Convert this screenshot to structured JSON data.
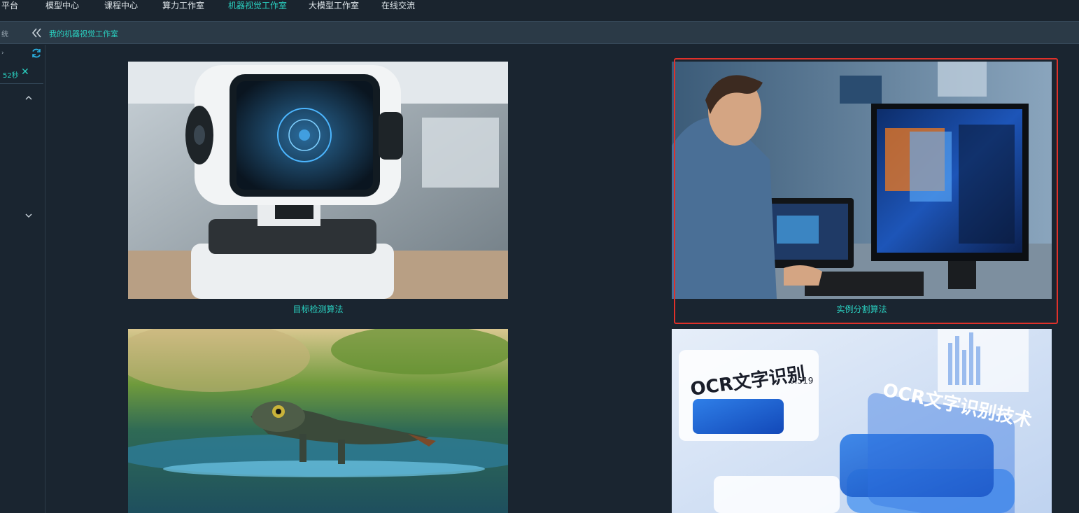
{
  "topbar": {
    "brand": "平台",
    "nav": [
      "模型中心",
      "课程中心",
      "算力工作室",
      "机器视觉工作室",
      "大模型工作室",
      "在线交流"
    ],
    "active_index": 3
  },
  "subbar": {
    "cut_text": "统",
    "collapse_icon": "double-chevron-left-icon",
    "breadcrumb": "我的机器视觉工作室"
  },
  "sidebar": {
    "arrow": "›",
    "refresh_icon": "refresh-icon",
    "timer": "52秒",
    "close_glyph": "✕",
    "chevron_up": "⌃",
    "chevron_down": "⌄"
  },
  "cards": [
    {
      "caption": "目标检测算法",
      "image": "robot-camera-image",
      "selected": false
    },
    {
      "caption": "实例分割算法",
      "image": "engineer-monitor-image",
      "selected": true
    },
    {
      "caption": "",
      "image": "lizard-water-image",
      "selected": false
    },
    {
      "caption": "",
      "image": "ocr-illustration-image",
      "selected": false
    }
  ],
  "ocr_image_text": {
    "left_title": "OCR文字识别",
    "right_title": "OCR文字识别技术",
    "number": "0.519"
  },
  "colors": {
    "accent": "#2ad0c0",
    "selection": "#e0312a",
    "background": "#1a2530"
  }
}
